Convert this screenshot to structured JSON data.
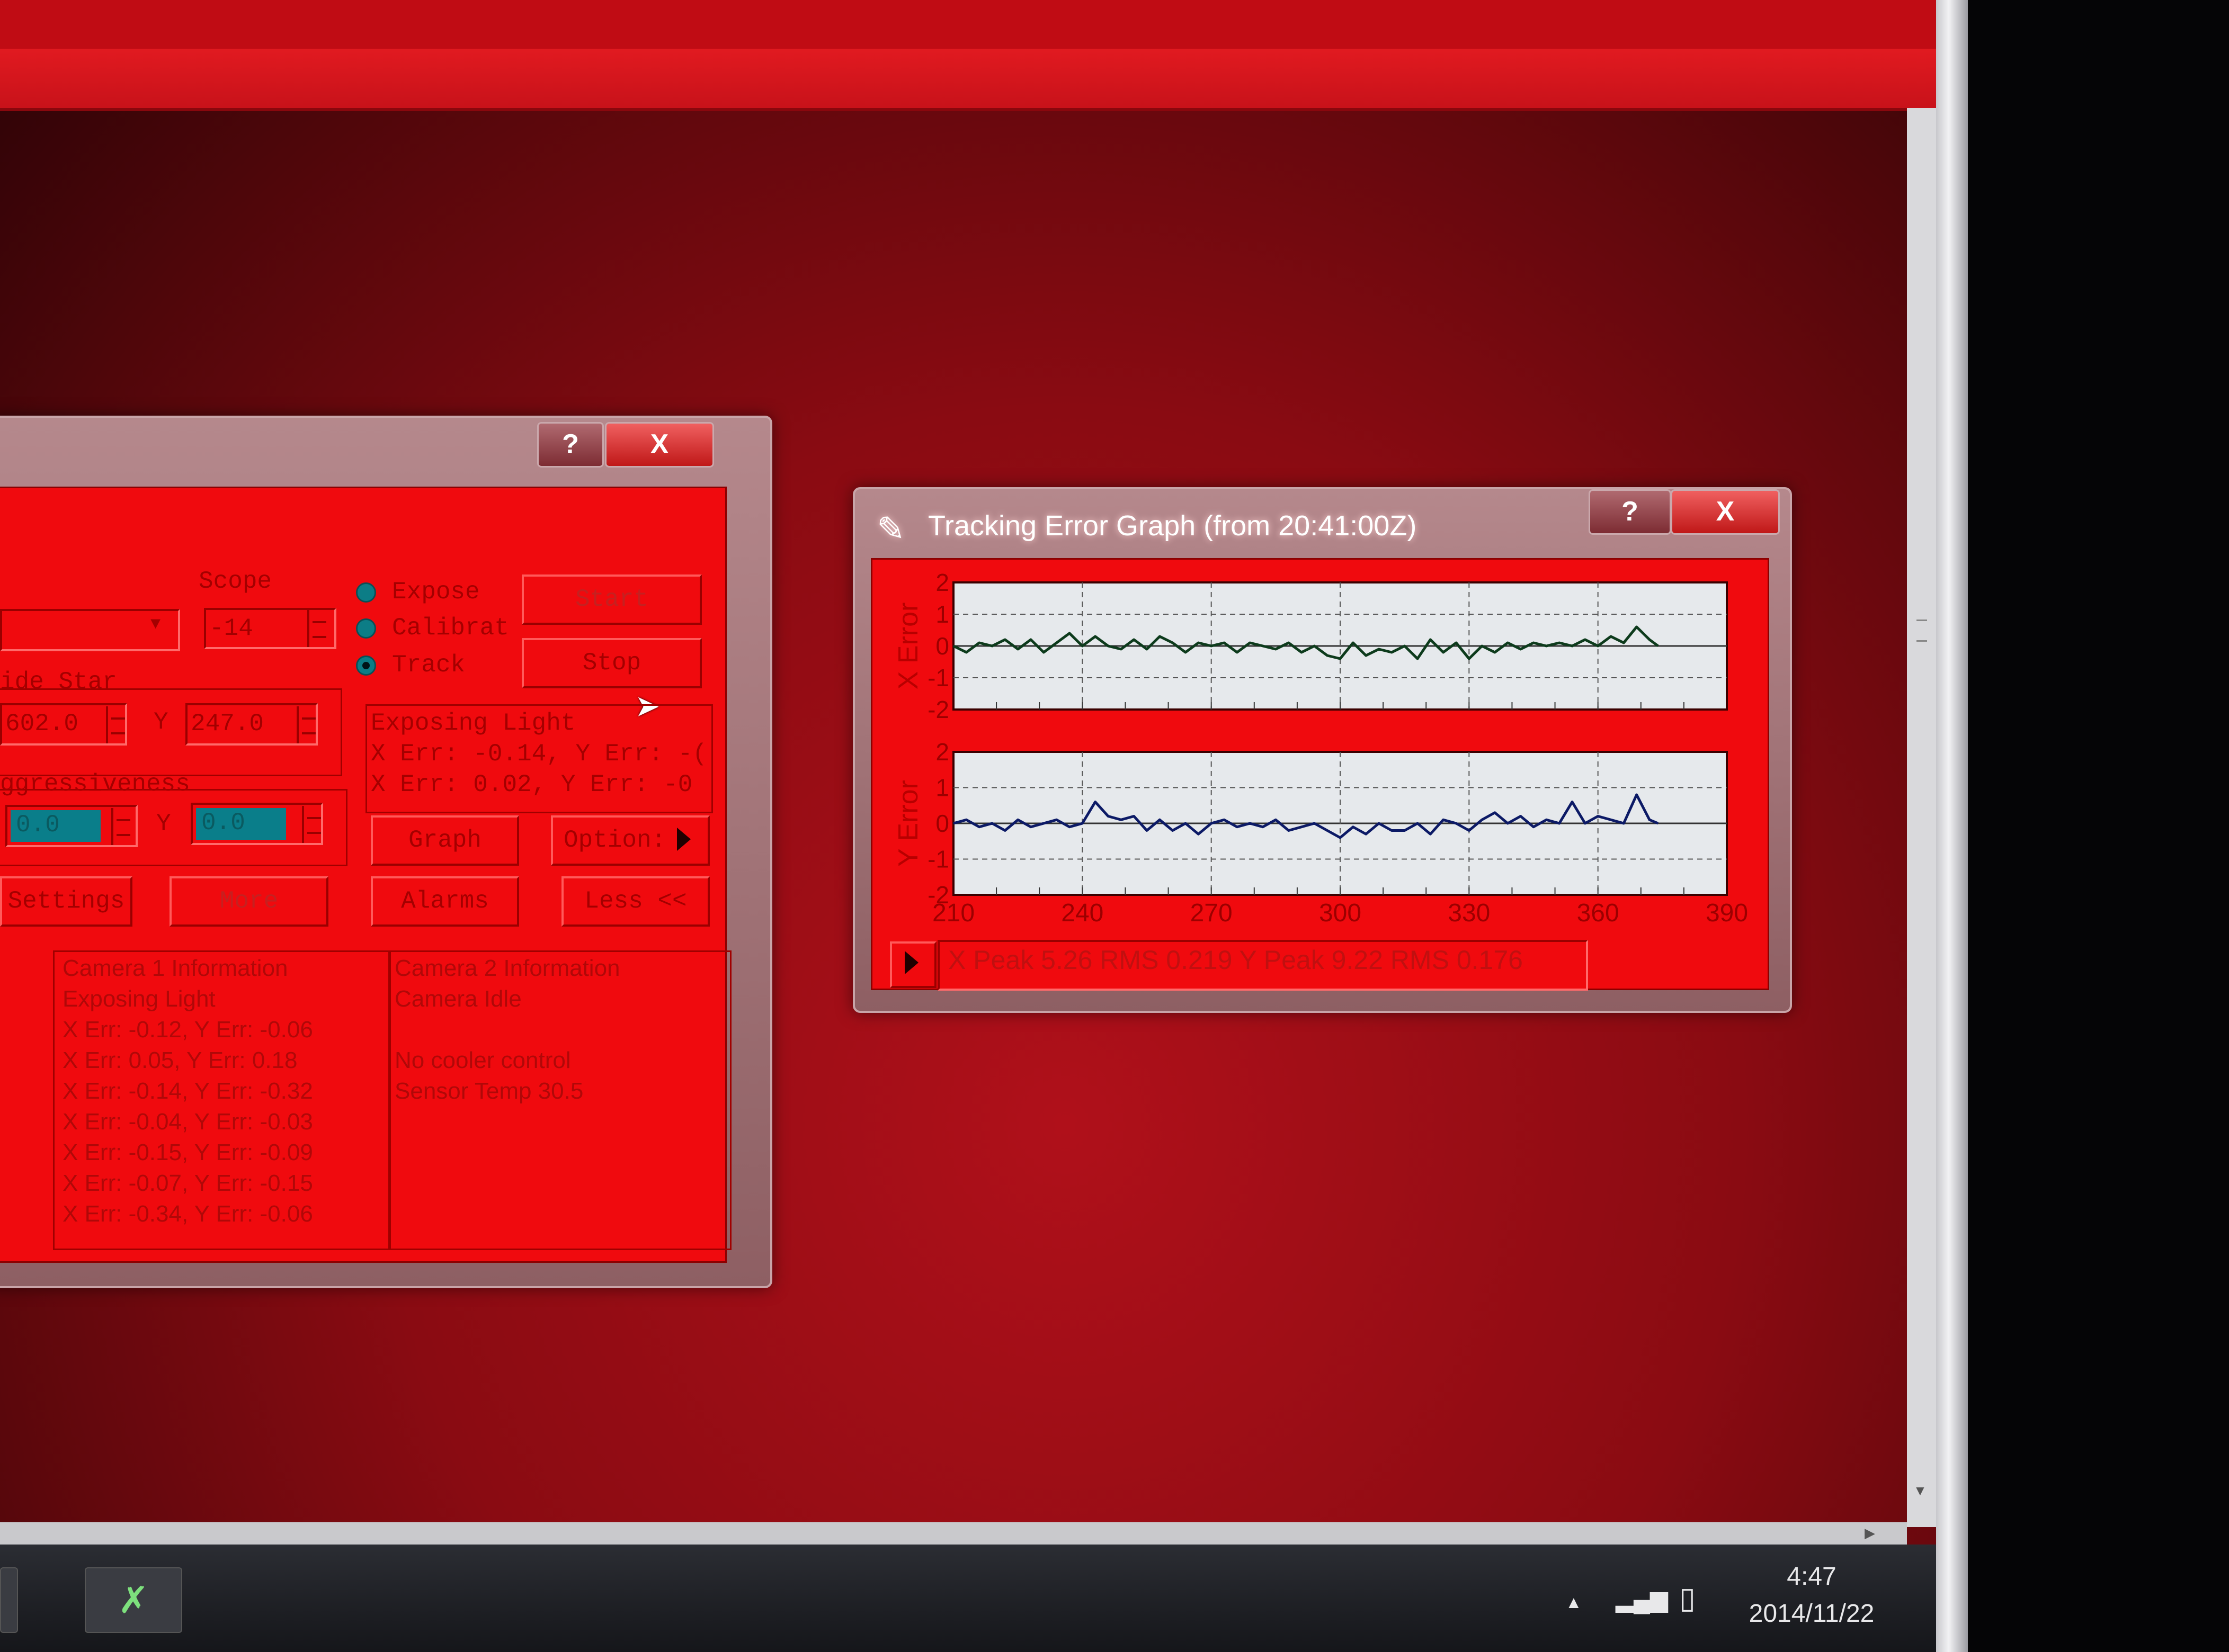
{
  "guiding_window": {
    "help_label": "?",
    "close_label": "X",
    "scope_label": "Scope",
    "scope_value": "-14",
    "radios": [
      {
        "label": "Expose",
        "selected": false
      },
      {
        "label": "Calibrat",
        "selected": false
      },
      {
        "label": "Track",
        "selected": true
      }
    ],
    "start_label": "Start",
    "stop_label": "Stop",
    "guide_star_label": "ide Star",
    "guide_star_x": "602.0",
    "y_label": "Y",
    "guide_star_y": "247.0",
    "aggressiveness_label": "ggressiveness",
    "aggr_x": "0.0",
    "aggr_y": "0.0",
    "status_lines": [
      "Exposing Light",
      "X Err: -0.14, Y Err: -(",
      "X Err: 0.02, Y Err: -0"
    ],
    "graph_label": "Graph",
    "options_label": "Option:",
    "settings_label": "Settings",
    "more_label": "More",
    "alarms_label": "Alarms",
    "less_label": "Less <<",
    "camera1_lines": [
      "Camera 1 Information",
      "Exposing Light",
      "X Err: -0.12, Y Err: -0.06",
      "X Err: 0.05, Y Err: 0.18",
      "X Err: -0.14, Y Err: -0.32",
      "X Err: -0.04, Y Err: -0.03",
      "X Err: -0.15, Y Err: -0.09",
      "X Err: -0.07, Y Err: -0.15",
      "X Err: -0.34, Y Err: -0.06"
    ],
    "camera2_lines": [
      "Camera 2 Information",
      "Camera Idle",
      "",
      "No cooler control",
      "Sensor Temp 30.5"
    ]
  },
  "graph_window": {
    "title": "Tracking Error Graph (from 20:41:00Z)",
    "help_label": "?",
    "close_label": "X",
    "stats": "X Peak 5.26   RMS 0.219    Y Peak 9.22   RMS 0.176"
  },
  "taskbar": {
    "time": "4:47",
    "date": "2014/11/22",
    "tray_up_icon": "▲",
    "signal_icon": "▂▄▆",
    "battery_icon": "▯"
  },
  "colors": {
    "background": "#8a0b12",
    "window_client": "#f00a0e",
    "x_trace": "#0d3b1c",
    "y_trace": "#0c1a66"
  },
  "chart_data": [
    {
      "type": "line",
      "ylabel": "X Error",
      "ylim": [
        -2,
        2
      ],
      "yticks": [
        "2",
        "1",
        "0",
        "-1",
        "-2"
      ],
      "xlim": [
        210,
        390
      ],
      "grid": true,
      "series": [
        {
          "values": [
            [
              210,
              0.0
            ],
            [
              213,
              -0.2
            ],
            [
              216,
              0.1
            ],
            [
              219,
              0.0
            ],
            [
              222,
              0.2
            ],
            [
              225,
              -0.1
            ],
            [
              228,
              0.2
            ],
            [
              231,
              -0.2
            ],
            [
              234,
              0.1
            ],
            [
              237,
              0.4
            ],
            [
              240,
              0.0
            ],
            [
              243,
              0.3
            ],
            [
              246,
              0.0
            ],
            [
              249,
              -0.1
            ],
            [
              252,
              0.2
            ],
            [
              255,
              -0.1
            ],
            [
              258,
              0.3
            ],
            [
              261,
              0.1
            ],
            [
              264,
              -0.2
            ],
            [
              267,
              0.1
            ],
            [
              270,
              0.0
            ],
            [
              273,
              0.1
            ],
            [
              276,
              -0.2
            ],
            [
              279,
              0.1
            ],
            [
              282,
              0.0
            ],
            [
              285,
              -0.1
            ],
            [
              288,
              0.1
            ],
            [
              291,
              -0.2
            ],
            [
              294,
              0.0
            ],
            [
              297,
              -0.3
            ],
            [
              300,
              -0.4
            ],
            [
              303,
              0.1
            ],
            [
              306,
              -0.3
            ],
            [
              309,
              -0.1
            ],
            [
              312,
              -0.2
            ],
            [
              315,
              0.0
            ],
            [
              318,
              -0.4
            ],
            [
              321,
              0.2
            ],
            [
              324,
              -0.2
            ],
            [
              327,
              0.1
            ],
            [
              330,
              -0.4
            ],
            [
              333,
              0.0
            ],
            [
              336,
              -0.2
            ],
            [
              339,
              0.1
            ],
            [
              342,
              -0.1
            ],
            [
              345,
              0.1
            ],
            [
              348,
              0.0
            ],
            [
              351,
              0.1
            ],
            [
              354,
              0.0
            ],
            [
              357,
              0.2
            ],
            [
              360,
              0.0
            ],
            [
              363,
              0.3
            ],
            [
              366,
              0.1
            ],
            [
              369,
              0.6
            ],
            [
              372,
              0.2
            ],
            [
              374,
              0.0
            ]
          ]
        }
      ]
    },
    {
      "type": "line",
      "ylabel": "Y Error",
      "ylim": [
        -2,
        2
      ],
      "yticks": [
        "2",
        "1",
        "0",
        "-1",
        "-2"
      ],
      "xlim": [
        210,
        390
      ],
      "xticks": [
        210,
        240,
        270,
        300,
        330,
        360,
        390
      ],
      "grid": true,
      "series": [
        {
          "values": [
            [
              210,
              0.0
            ],
            [
              213,
              0.1
            ],
            [
              216,
              -0.1
            ],
            [
              219,
              0.0
            ],
            [
              222,
              -0.2
            ],
            [
              225,
              0.1
            ],
            [
              228,
              -0.1
            ],
            [
              231,
              0.0
            ],
            [
              234,
              0.1
            ],
            [
              237,
              -0.1
            ],
            [
              240,
              0.0
            ],
            [
              243,
              0.6
            ],
            [
              246,
              0.2
            ],
            [
              249,
              0.1
            ],
            [
              252,
              0.2
            ],
            [
              255,
              -0.2
            ],
            [
              258,
              0.1
            ],
            [
              261,
              -0.2
            ],
            [
              264,
              0.0
            ],
            [
              267,
              -0.3
            ],
            [
              270,
              0.0
            ],
            [
              273,
              0.1
            ],
            [
              276,
              -0.1
            ],
            [
              279,
              0.0
            ],
            [
              282,
              -0.1
            ],
            [
              285,
              0.1
            ],
            [
              288,
              -0.2
            ],
            [
              291,
              -0.1
            ],
            [
              294,
              0.0
            ],
            [
              297,
              -0.2
            ],
            [
              300,
              -0.4
            ],
            [
              303,
              -0.1
            ],
            [
              306,
              -0.3
            ],
            [
              309,
              0.0
            ],
            [
              312,
              -0.2
            ],
            [
              315,
              -0.2
            ],
            [
              318,
              0.0
            ],
            [
              321,
              -0.3
            ],
            [
              324,
              0.1
            ],
            [
              327,
              0.0
            ],
            [
              330,
              -0.2
            ],
            [
              333,
              0.1
            ],
            [
              336,
              0.3
            ],
            [
              339,
              0.0
            ],
            [
              342,
              0.2
            ],
            [
              345,
              -0.1
            ],
            [
              348,
              0.1
            ],
            [
              351,
              0.0
            ],
            [
              354,
              0.6
            ],
            [
              357,
              0.0
            ],
            [
              360,
              0.2
            ],
            [
              363,
              0.1
            ],
            [
              366,
              0.0
            ],
            [
              369,
              0.8
            ],
            [
              372,
              0.1
            ],
            [
              374,
              0.0
            ]
          ]
        }
      ]
    }
  ]
}
